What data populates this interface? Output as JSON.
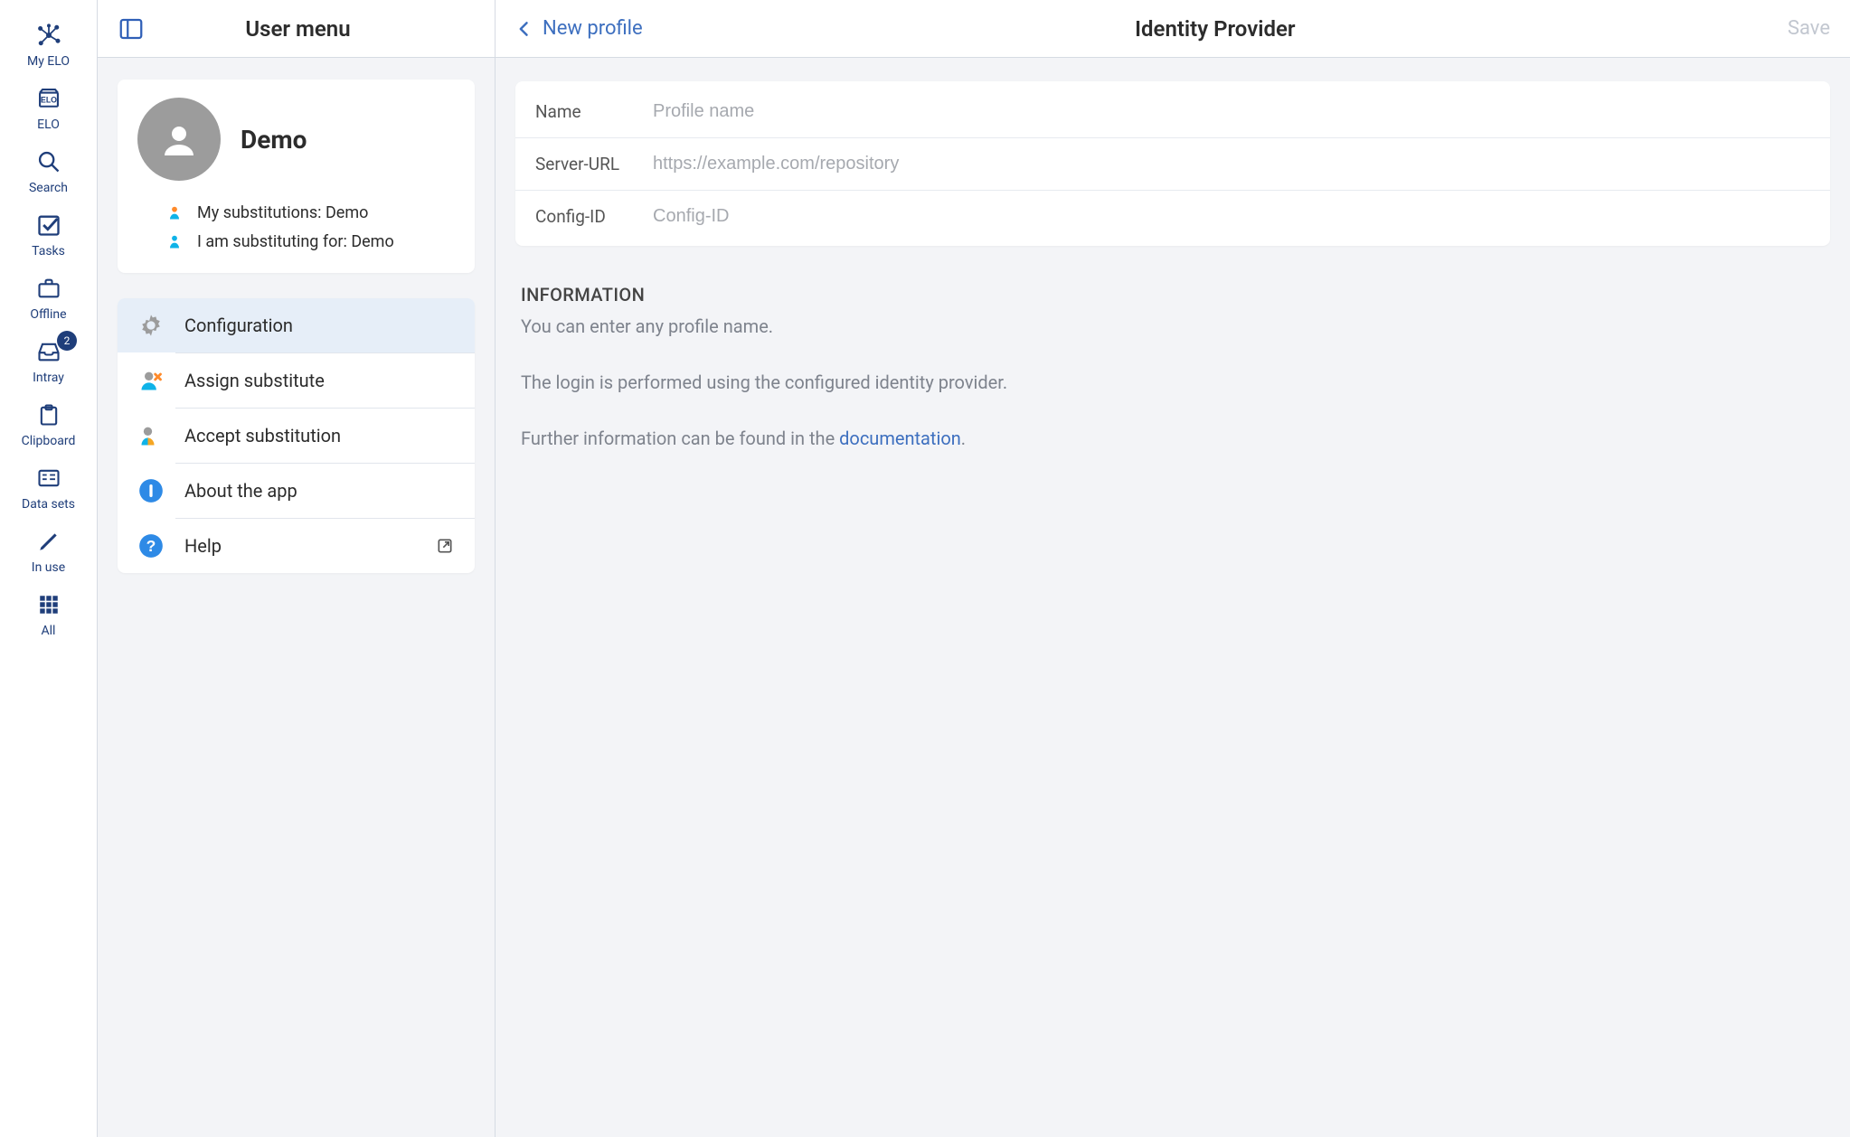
{
  "rail": {
    "items": [
      {
        "label": "My ELO"
      },
      {
        "label": "ELO"
      },
      {
        "label": "Search"
      },
      {
        "label": "Tasks"
      },
      {
        "label": "Offline"
      },
      {
        "label": "Intray",
        "badge": "2"
      },
      {
        "label": "Clipboard"
      },
      {
        "label": "Data sets"
      },
      {
        "label": "In use"
      },
      {
        "label": "All"
      }
    ]
  },
  "middle": {
    "header_title": "User menu",
    "user": {
      "name": "Demo",
      "sub_my_label": "My substitutions: Demo",
      "sub_for_label": "I am substituting for: Demo"
    },
    "menu": [
      {
        "label": "Configuration"
      },
      {
        "label": "Assign substitute"
      },
      {
        "label": "Accept substitution"
      },
      {
        "label": "About the app"
      },
      {
        "label": "Help"
      }
    ]
  },
  "main": {
    "back_label": "New profile",
    "title": "Identity Provider",
    "save_label": "Save",
    "fields": {
      "name_label": "Name",
      "name_placeholder": "Profile name",
      "url_label": "Server-URL",
      "url_placeholder": "https://example.com/repository",
      "config_label": "Config-ID",
      "config_placeholder": "Config-ID"
    },
    "info": {
      "heading": "INFORMATION",
      "line1": "You can enter any profile name.",
      "line2": "The login is performed using the configured identity provider.",
      "line3_pre": "Further information can be found in the ",
      "line3_link": "documentation",
      "line3_post": "."
    }
  }
}
